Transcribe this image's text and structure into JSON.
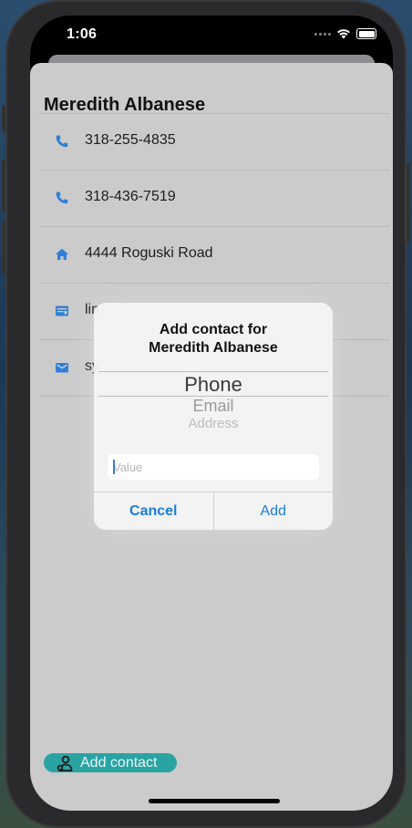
{
  "status": {
    "time": "1:06"
  },
  "contact": {
    "name": "Meredith Albanese",
    "rows": [
      {
        "icon": "phone-icon",
        "value": "318-255-4835"
      },
      {
        "icon": "phone-icon",
        "value": "318-436-7519"
      },
      {
        "icon": "home-icon",
        "value": "4444 Roguski Road"
      },
      {
        "icon": "id-card-icon",
        "value": "lin"
      },
      {
        "icon": "mail-icon",
        "value": "sy"
      }
    ]
  },
  "add_contact_button": {
    "label": "Add contact",
    "icon": "add-person-icon"
  },
  "alert": {
    "title_line1": "Add contact for",
    "title_line2": "Meredith Albanese",
    "picker": {
      "selected": "Phone",
      "options": [
        "Email",
        "Address"
      ]
    },
    "input": {
      "placeholder": "Value",
      "value": ""
    },
    "cancel_label": "Cancel",
    "add_label": "Add"
  },
  "colors": {
    "accent": "#1a7ed9",
    "button_teal": "#2aa3a3",
    "sheet": "#cbcbcb"
  }
}
